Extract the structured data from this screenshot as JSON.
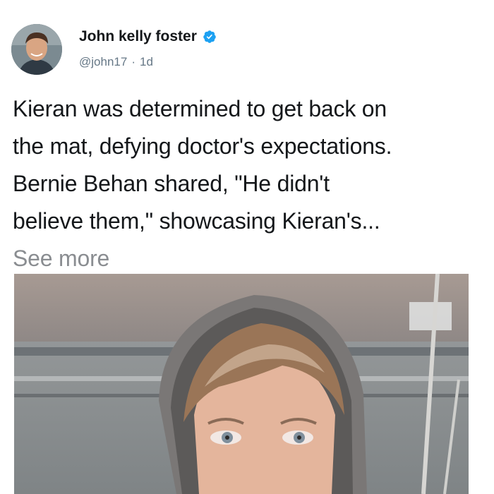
{
  "post": {
    "author_name": "John kelly foster",
    "handle": "@john17",
    "separator": "·",
    "time_ago": "1d",
    "verified_icon": "verified-badge-icon",
    "body_lines": [
      "Kieran was determined to get back on",
      "the mat, defying doctor's expectations.",
      "Bernie Behan shared, \"He didn't",
      "believe them,\" showcasing Kieran's..."
    ],
    "see_more": "See more"
  },
  "colors": {
    "text": "#14171a",
    "muted": "#657786",
    "see_more": "#8a8d91",
    "verified": "#1da1f2",
    "background": "#ffffff"
  }
}
